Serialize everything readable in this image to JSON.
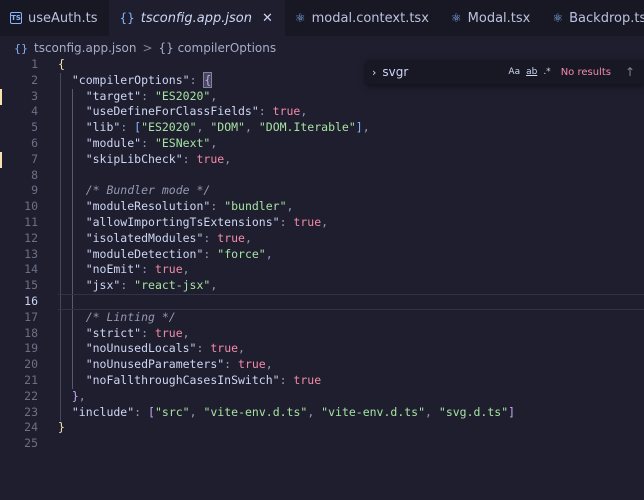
{
  "tabs": [
    {
      "label": "useAuth.ts",
      "icon": "ts-icon",
      "active": false
    },
    {
      "label": "tsconfig.app.json",
      "icon": "json-icon",
      "active": true
    },
    {
      "label": "modal.context.tsx",
      "icon": "react-icon",
      "active": false
    },
    {
      "label": "Modal.tsx",
      "icon": "react-icon",
      "active": false
    },
    {
      "label": "Backdrop.tsx",
      "icon": "react-icon",
      "active": false
    }
  ],
  "breadcrumb": {
    "file": "tsconfig.app.json",
    "separator": ">",
    "symbol": "{} compilerOptions"
  },
  "find": {
    "query": "svgr",
    "opt_case": "Aa",
    "opt_word": "ab",
    "opt_regex": ".*",
    "result": "No results"
  },
  "active_line": 16,
  "colors": {
    "string": "#a6e3a1",
    "boolean": "#f38ba8",
    "comment": "#9399b2",
    "bracket1": "#f9e2af",
    "bracket2": "#cba6f7",
    "bracket3": "#89b4fa"
  },
  "code_lines": [
    {
      "n": "1",
      "t": [
        {
          "c": "br1",
          "v": "{"
        }
      ]
    },
    {
      "n": "2",
      "t": [
        {
          "c": "k",
          "v": "  \"compilerOptions\""
        },
        {
          "c": "p",
          "v": ": "
        },
        {
          "c": "br2 hl",
          "v": "{"
        }
      ]
    },
    {
      "n": "3",
      "t": [
        {
          "c": "k",
          "v": "    \"target\""
        },
        {
          "c": "p",
          "v": ": "
        },
        {
          "c": "s",
          "v": "\"ES2020\""
        },
        {
          "c": "p",
          "v": ","
        }
      ]
    },
    {
      "n": "4",
      "t": [
        {
          "c": "k",
          "v": "    \"useDefineForClassFields\""
        },
        {
          "c": "p",
          "v": ": "
        },
        {
          "c": "b",
          "v": "true"
        },
        {
          "c": "p",
          "v": ","
        }
      ]
    },
    {
      "n": "5",
      "t": [
        {
          "c": "k",
          "v": "    \"lib\""
        },
        {
          "c": "p",
          "v": ": "
        },
        {
          "c": "br3",
          "v": "["
        },
        {
          "c": "s",
          "v": "\"ES2020\""
        },
        {
          "c": "p",
          "v": ", "
        },
        {
          "c": "s",
          "v": "\"DOM\""
        },
        {
          "c": "p",
          "v": ", "
        },
        {
          "c": "s",
          "v": "\"DOM.Iterable\""
        },
        {
          "c": "br3",
          "v": "]"
        },
        {
          "c": "p",
          "v": ","
        }
      ]
    },
    {
      "n": "6",
      "t": [
        {
          "c": "k",
          "v": "    \"module\""
        },
        {
          "c": "p",
          "v": ": "
        },
        {
          "c": "s",
          "v": "\"ESNext\""
        },
        {
          "c": "p",
          "v": ","
        }
      ]
    },
    {
      "n": "7",
      "t": [
        {
          "c": "k",
          "v": "    \"skipLibCheck\""
        },
        {
          "c": "p",
          "v": ": "
        },
        {
          "c": "b",
          "v": "true"
        },
        {
          "c": "p",
          "v": ","
        }
      ]
    },
    {
      "n": "8",
      "t": []
    },
    {
      "n": "9",
      "t": [
        {
          "c": "cm",
          "v": "    /* Bundler mode */"
        }
      ]
    },
    {
      "n": "10",
      "t": [
        {
          "c": "k",
          "v": "    \"moduleResolution\""
        },
        {
          "c": "p",
          "v": ": "
        },
        {
          "c": "s",
          "v": "\"bundler\""
        },
        {
          "c": "p",
          "v": ","
        }
      ]
    },
    {
      "n": "11",
      "t": [
        {
          "c": "k",
          "v": "    \"allowImportingTsExtensions\""
        },
        {
          "c": "p",
          "v": ": "
        },
        {
          "c": "b",
          "v": "true"
        },
        {
          "c": "p",
          "v": ","
        }
      ]
    },
    {
      "n": "12",
      "t": [
        {
          "c": "k",
          "v": "    \"isolatedModules\""
        },
        {
          "c": "p",
          "v": ": "
        },
        {
          "c": "b",
          "v": "true"
        },
        {
          "c": "p",
          "v": ","
        }
      ]
    },
    {
      "n": "13",
      "t": [
        {
          "c": "k",
          "v": "    \"moduleDetection\""
        },
        {
          "c": "p",
          "v": ": "
        },
        {
          "c": "s",
          "v": "\"force\""
        },
        {
          "c": "p",
          "v": ","
        }
      ]
    },
    {
      "n": "14",
      "t": [
        {
          "c": "k",
          "v": "    \"noEmit\""
        },
        {
          "c": "p",
          "v": ": "
        },
        {
          "c": "b",
          "v": "true"
        },
        {
          "c": "p",
          "v": ","
        }
      ]
    },
    {
      "n": "15",
      "t": [
        {
          "c": "k",
          "v": "    \"jsx\""
        },
        {
          "c": "p",
          "v": ": "
        },
        {
          "c": "s",
          "v": "\"react-jsx\""
        },
        {
          "c": "p",
          "v": ","
        }
      ]
    },
    {
      "n": "16",
      "t": []
    },
    {
      "n": "17",
      "t": [
        {
          "c": "cm",
          "v": "    /* Linting */"
        }
      ]
    },
    {
      "n": "18",
      "t": [
        {
          "c": "k",
          "v": "    \"strict\""
        },
        {
          "c": "p",
          "v": ": "
        },
        {
          "c": "b",
          "v": "true"
        },
        {
          "c": "p",
          "v": ","
        }
      ]
    },
    {
      "n": "19",
      "t": [
        {
          "c": "k",
          "v": "    \"noUnusedLocals\""
        },
        {
          "c": "p",
          "v": ": "
        },
        {
          "c": "b",
          "v": "true"
        },
        {
          "c": "p",
          "v": ","
        }
      ]
    },
    {
      "n": "20",
      "t": [
        {
          "c": "k",
          "v": "    \"noUnusedParameters\""
        },
        {
          "c": "p",
          "v": ": "
        },
        {
          "c": "b",
          "v": "true"
        },
        {
          "c": "p",
          "v": ","
        }
      ]
    },
    {
      "n": "21",
      "t": [
        {
          "c": "k",
          "v": "    \"noFallthroughCasesInSwitch\""
        },
        {
          "c": "p",
          "v": ": "
        },
        {
          "c": "b",
          "v": "true"
        }
      ]
    },
    {
      "n": "22",
      "t": [
        {
          "c": "br2",
          "v": "  }"
        },
        {
          "c": "p",
          "v": ","
        }
      ]
    },
    {
      "n": "23",
      "t": [
        {
          "c": "k",
          "v": "  \"include\""
        },
        {
          "c": "p",
          "v": ": "
        },
        {
          "c": "br2",
          "v": "["
        },
        {
          "c": "s",
          "v": "\"src\""
        },
        {
          "c": "p",
          "v": ", "
        },
        {
          "c": "s",
          "v": "\"vite-env.d.ts\""
        },
        {
          "c": "p",
          "v": ", "
        },
        {
          "c": "s",
          "v": "\"vite-env.d.ts\""
        },
        {
          "c": "p",
          "v": ", "
        },
        {
          "c": "s",
          "v": "\"svg.d.ts\""
        },
        {
          "c": "br2",
          "v": "]"
        }
      ]
    },
    {
      "n": "24",
      "t": [
        {
          "c": "br1",
          "v": "}"
        }
      ]
    },
    {
      "n": "25",
      "t": []
    }
  ]
}
